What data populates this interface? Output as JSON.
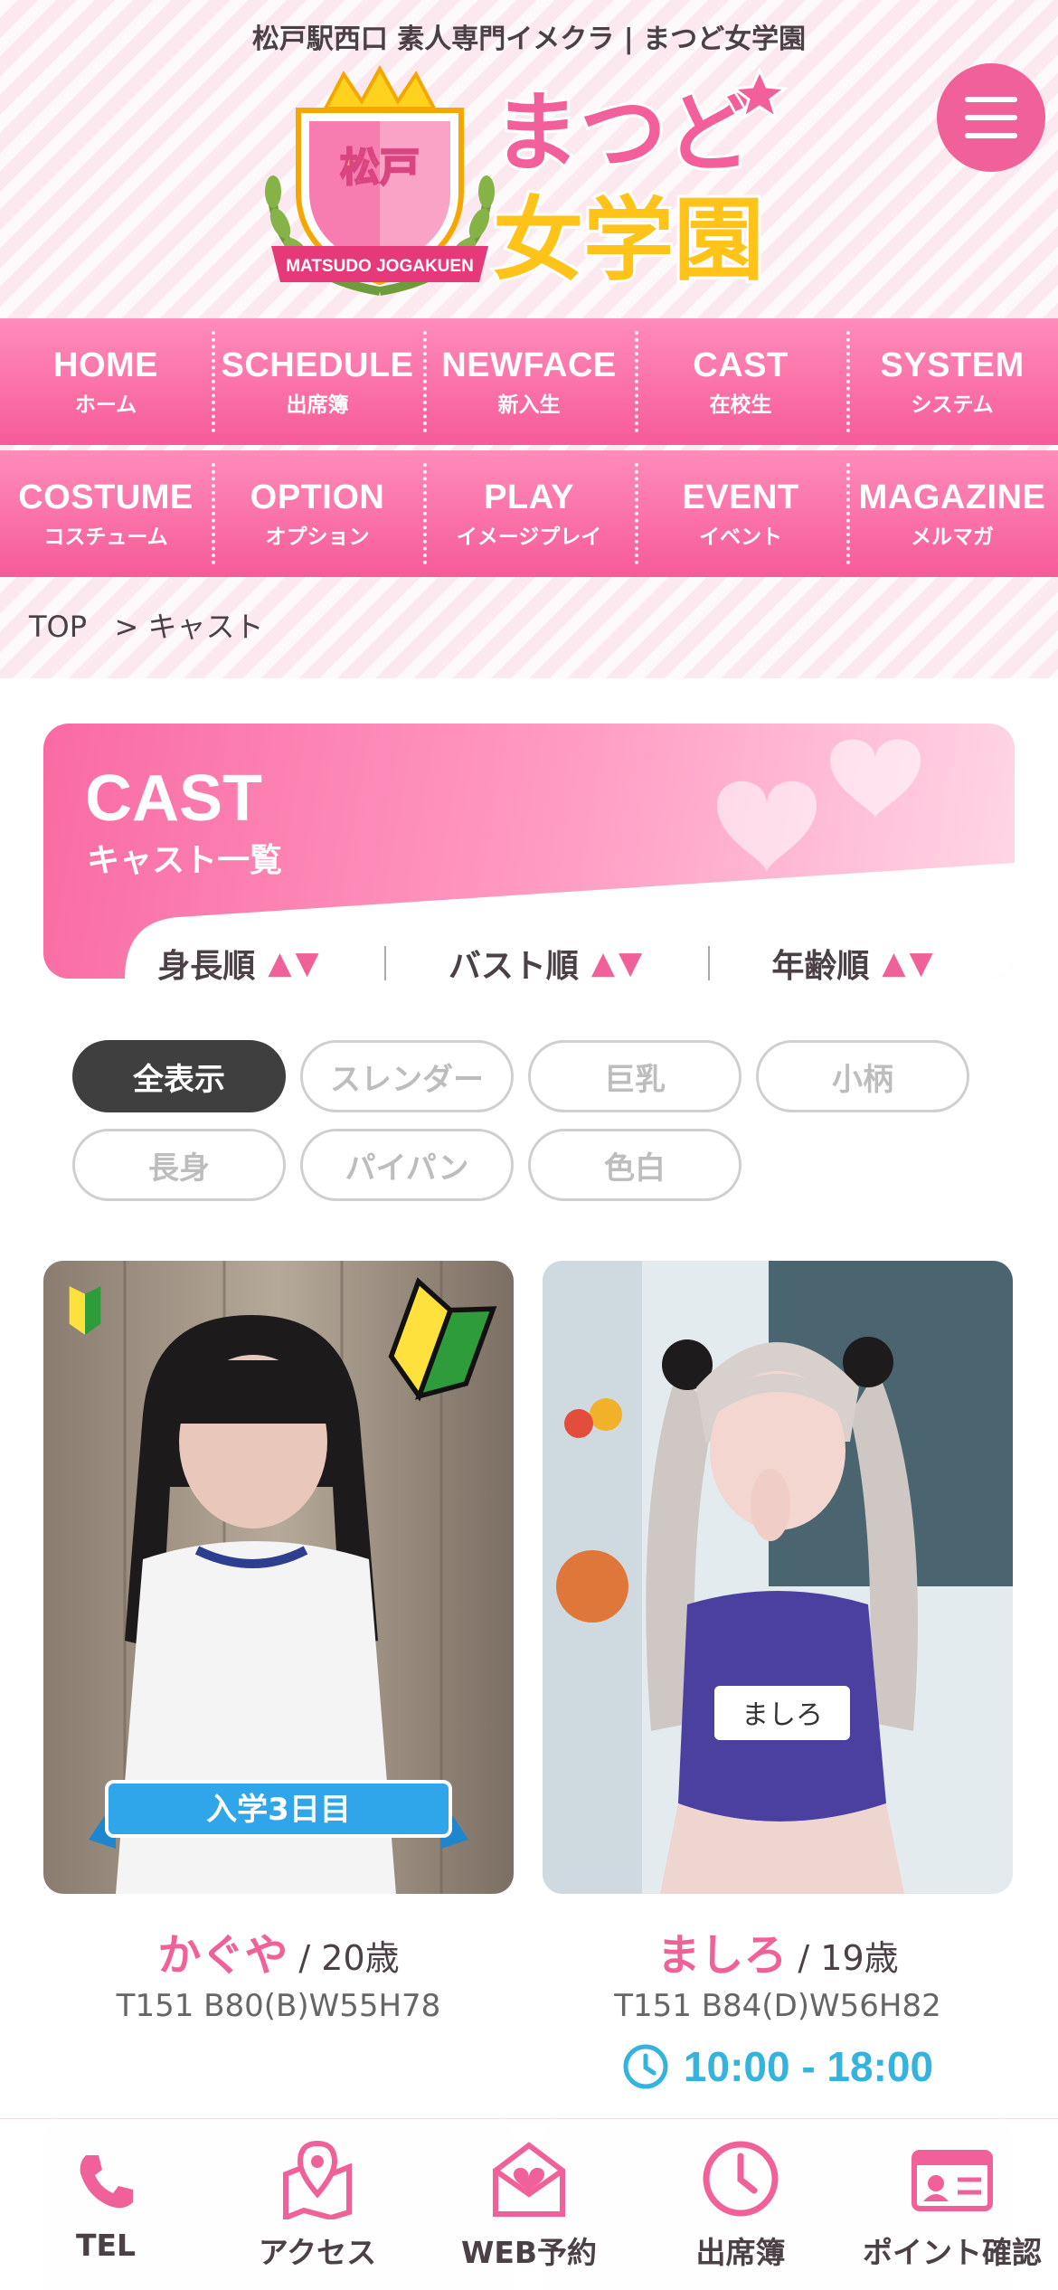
{
  "header": {
    "tagline": "松戸駅西口 素人専門イメクラ | まつど女学園",
    "logo": {
      "crest_text": "松戸",
      "ribbon_text": "MATSUDO JOGAKUEN",
      "title_line1": "まつど",
      "title_line2": "女学園"
    },
    "menu_icon": "hamburger-icon"
  },
  "nav": {
    "row1": [
      {
        "en": "HOME",
        "ja": "ホーム"
      },
      {
        "en": "SCHEDULE",
        "ja": "出席簿"
      },
      {
        "en": "NEWFACE",
        "ja": "新入生"
      },
      {
        "en": "CAST",
        "ja": "在校生"
      },
      {
        "en": "SYSTEM",
        "ja": "システム"
      }
    ],
    "row2": [
      {
        "en": "COSTUME",
        "ja": "コスチューム"
      },
      {
        "en": "OPTION",
        "ja": "オプション"
      },
      {
        "en": "PLAY",
        "ja": "イメージプレイ"
      },
      {
        "en": "EVENT",
        "ja": "イベント"
      },
      {
        "en": "MAGAZINE",
        "ja": "メルマガ"
      }
    ]
  },
  "breadcrumb": {
    "home": "TOP",
    "sep": ">",
    "current": "キャスト"
  },
  "cast_section": {
    "title": "CAST",
    "subtitle": "キャスト一覧",
    "sort": [
      {
        "label": "身長順",
        "arrows": "▲▼"
      },
      {
        "label": "バスト順",
        "arrows": "▲▼"
      },
      {
        "label": "年齢順",
        "arrows": "▲▼"
      }
    ],
    "filters": [
      "全表示",
      "スレンダー",
      "巨乳",
      "小柄",
      "長身",
      "パイパン",
      "色白"
    ],
    "active_filter": "全表示"
  },
  "casts": [
    {
      "name": "かぐや",
      "age": " / 20歳",
      "stats": "T151 B80(B)W55H78",
      "banner": "入学3日目",
      "badge": "beginner-mark-icon"
    },
    {
      "name": "ましろ",
      "age": " / 19歳",
      "stats": "T151 B84(D)W56H82",
      "time": "10:00 - 18:00",
      "name_tag": "ましろ"
    }
  ],
  "bottom_bar": [
    {
      "label": "TEL",
      "icon": "phone-icon"
    },
    {
      "label": "アクセス",
      "icon": "map-pin-icon"
    },
    {
      "label": "WEB予約",
      "icon": "mail-heart-icon"
    },
    {
      "label": "出席簿",
      "icon": "clock-icon"
    },
    {
      "label": "ポイント確認",
      "icon": "id-card-icon"
    }
  ],
  "colors": {
    "accent": "#f0619a",
    "time": "#34b3dc",
    "text": "#4a4045"
  }
}
